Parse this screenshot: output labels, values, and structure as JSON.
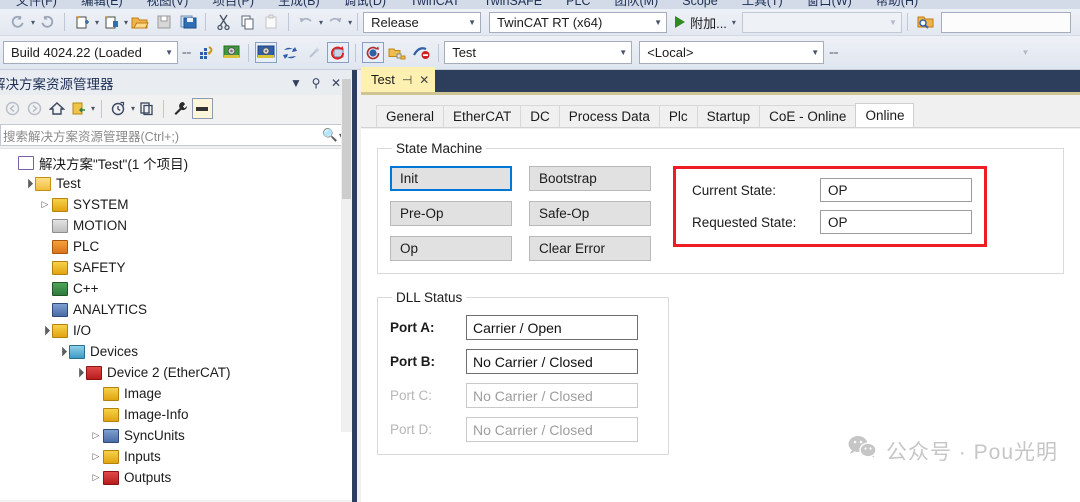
{
  "menubar": {
    "items": [
      {
        "label": "文件(F)"
      },
      {
        "label": "编辑(E)"
      },
      {
        "label": "视图(V)"
      },
      {
        "label": "项目(P)"
      },
      {
        "label": "生成(B)"
      },
      {
        "label": "调试(D)"
      },
      {
        "label": "TwinCAT"
      },
      {
        "label": "TwinSAFE"
      },
      {
        "label": "PLC"
      },
      {
        "label": "团队(M)"
      },
      {
        "label": "Scope"
      },
      {
        "label": "工具(T)"
      },
      {
        "label": "窗口(W)"
      },
      {
        "label": "帮助(H)"
      }
    ]
  },
  "toolbar1": {
    "icons": [
      {
        "name": "navigate-back-icon",
        "glyph": "↺"
      },
      {
        "name": "navigate-forward-icon",
        "glyph": "↻"
      },
      {
        "name": "new-project-icon",
        "glyph": "✲"
      },
      {
        "name": "new-item-icon",
        "glyph": "✳"
      },
      {
        "name": "open-file-icon",
        "glyph": "📂"
      },
      {
        "name": "save-icon",
        "glyph": "💾"
      },
      {
        "name": "save-all-icon",
        "glyph": "🖫"
      },
      {
        "name": "cut-icon",
        "glyph": "✂"
      },
      {
        "name": "copy-icon",
        "glyph": "⧉"
      },
      {
        "name": "paste-icon",
        "glyph": "📋"
      },
      {
        "name": "undo-icon",
        "glyph": "↶"
      },
      {
        "name": "redo-icon",
        "glyph": "↷"
      }
    ],
    "configuration": {
      "value": "Release",
      "label": "Release"
    },
    "platform": {
      "value": "TwinCAT RT (x64)",
      "label": "TwinCAT RT (x64)"
    },
    "run_label": "附加...",
    "process": {
      "value": "",
      "placeholder": ""
    },
    "find_icon": "search-folder-icon",
    "quick_launch": {
      "value": "",
      "placeholder": ""
    }
  },
  "toolbar2": {
    "build_version": {
      "value": "Build 4024.22 (Loaded"
    },
    "icons": [
      {
        "name": "activate-config-icon"
      },
      {
        "name": "restart-twincat-config-icon"
      },
      {
        "name": "restart-twincat-run-icon"
      },
      {
        "name": "reload-devices-icon"
      },
      {
        "name": "toggle-free-run-icon"
      },
      {
        "name": "show-online-data-icon"
      },
      {
        "name": "choose-target-icon"
      },
      {
        "name": "scan-devices-icon"
      },
      {
        "name": "disconnect-icon"
      }
    ],
    "target_project": {
      "value": "Test"
    },
    "target_system": {
      "value": "<Local>"
    }
  },
  "solution_explorer": {
    "title": "解决方案资源管理器",
    "title_buttons": [
      {
        "name": "panel-dropdown-icon",
        "glyph": "▾"
      },
      {
        "name": "pin-icon",
        "glyph": "⚲"
      },
      {
        "name": "close-icon",
        "glyph": "✕"
      }
    ],
    "toolbar_icons": [
      {
        "name": "back-icon",
        "glyph": "◐"
      },
      {
        "name": "forward-icon",
        "glyph": "◑"
      },
      {
        "name": "home-icon",
        "glyph": "⌂"
      },
      {
        "name": "sync-with-active-document-icon",
        "glyph": "⇄"
      },
      {
        "name": "pending-changes-icon",
        "glyph": "◷"
      },
      {
        "name": "refresh-icon",
        "glyph": "⧉"
      },
      {
        "name": "properties-icon",
        "glyph": "🔧"
      },
      {
        "name": "preview-selected-items-icon",
        "glyph": "▬"
      }
    ],
    "search": {
      "placeholder": "搜索解决方案资源管理器(Ctrl+;)",
      "value": ""
    },
    "search_icon": "magnifier-icon",
    "tree": [
      {
        "label": "解决方案\"Test\"(1 个项目)",
        "indent": 0,
        "expander": "",
        "icon": "solution-icon",
        "icon_class": "ic-solution"
      },
      {
        "label": "Test",
        "indent": 1,
        "expander": "▲",
        "icon": "project-icon",
        "icon_class": "ic-folderyellow"
      },
      {
        "label": "SYSTEM",
        "indent": 2,
        "expander": "▶",
        "icon": "system-icon",
        "icon_class": "ic-yellow"
      },
      {
        "label": "MOTION",
        "indent": 2,
        "expander": "",
        "icon": "motion-icon",
        "icon_class": "ic-gray"
      },
      {
        "label": "PLC",
        "indent": 2,
        "expander": "",
        "icon": "plc-icon",
        "icon_class": "ic-orange"
      },
      {
        "label": "SAFETY",
        "indent": 2,
        "expander": "",
        "icon": "safety-icon",
        "icon_class": "ic-yellow"
      },
      {
        "label": "C++",
        "indent": 2,
        "expander": "",
        "icon": "cpp-icon",
        "icon_class": "ic-green"
      },
      {
        "label": "ANALYTICS",
        "indent": 2,
        "expander": "",
        "icon": "analytics-icon",
        "icon_class": "ic-blue"
      },
      {
        "label": "I/O",
        "indent": 2,
        "expander": "▲",
        "icon": "io-icon",
        "icon_class": "ic-yellow"
      },
      {
        "label": "Devices",
        "indent": 3,
        "expander": "▲",
        "icon": "devices-icon",
        "icon_class": "ic-teal"
      },
      {
        "label": "Device 2 (EtherCAT)",
        "indent": 4,
        "expander": "▲",
        "icon": "ethercat-device-icon",
        "icon_class": "ic-red"
      },
      {
        "label": "Image",
        "indent": 5,
        "expander": "",
        "icon": "image-icon",
        "icon_class": "ic-yellow"
      },
      {
        "label": "Image-Info",
        "indent": 5,
        "expander": "",
        "icon": "image-info-icon",
        "icon_class": "ic-yellow"
      },
      {
        "label": "SyncUnits",
        "indent": 5,
        "expander": "▶",
        "icon": "sync-units-icon",
        "icon_class": "ic-blue"
      },
      {
        "label": "Inputs",
        "indent": 5,
        "expander": "▶",
        "icon": "inputs-icon",
        "icon_class": "ic-yellow"
      },
      {
        "label": "Outputs",
        "indent": 5,
        "expander": "▶",
        "icon": "outputs-icon",
        "icon_class": "ic-red"
      }
    ]
  },
  "document": {
    "tab": {
      "label": "Test",
      "pin_glyph": "⊣",
      "close_glyph": "✕"
    },
    "subtabs": [
      {
        "label": "General",
        "active": false
      },
      {
        "label": "EtherCAT",
        "active": false
      },
      {
        "label": "DC",
        "active": false
      },
      {
        "label": "Process Data",
        "active": false
      },
      {
        "label": "Plc",
        "active": false
      },
      {
        "label": "Startup",
        "active": false
      },
      {
        "label": "CoE - Online",
        "active": false
      },
      {
        "label": "Online",
        "active": true
      }
    ]
  },
  "state_machine": {
    "legend": "State Machine",
    "buttons_col1": [
      {
        "label": "Init",
        "focused": true
      },
      {
        "label": "Pre-Op",
        "focused": false
      },
      {
        "label": "Op",
        "focused": false
      }
    ],
    "buttons_col2": [
      {
        "label": "Bootstrap",
        "focused": false
      },
      {
        "label": "Safe-Op",
        "focused": false
      },
      {
        "label": "Clear Error",
        "focused": false
      }
    ],
    "highlight_color": "#ee1c25",
    "current_state": {
      "label": "Current State:",
      "value": "OP"
    },
    "requested_state": {
      "label": "Requested State:",
      "value": "OP"
    }
  },
  "dll_status": {
    "legend": "DLL Status",
    "ports": [
      {
        "label": "Port A:",
        "value": "Carrier / Open",
        "enabled": true
      },
      {
        "label": "Port B:",
        "value": "No Carrier / Closed",
        "enabled": true
      },
      {
        "label": "Port C:",
        "value": "No Carrier / Closed",
        "enabled": false
      },
      {
        "label": "Port D:",
        "value": "No Carrier / Closed",
        "enabled": false
      }
    ]
  },
  "watermark": {
    "text": "公众号 · Pou光明",
    "icon": "wechat-icon"
  }
}
